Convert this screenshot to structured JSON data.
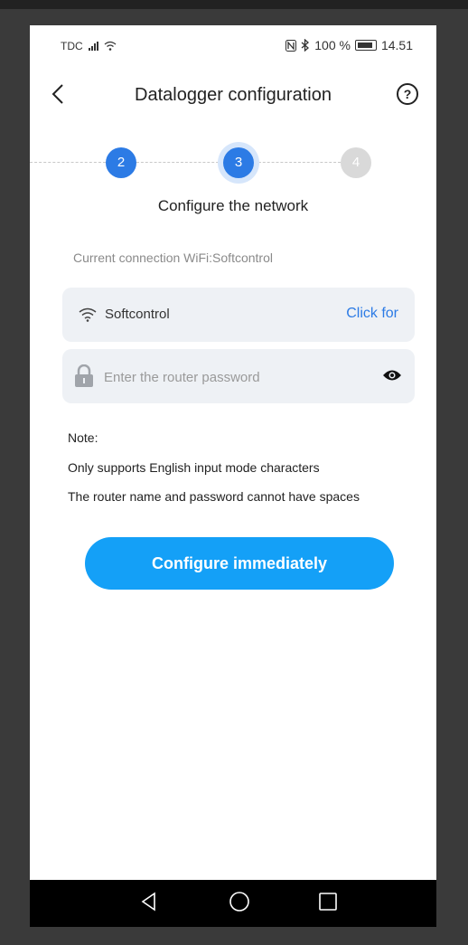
{
  "status_bar": {
    "carrier": "TDC",
    "battery_text": "100 %",
    "time": "14.51"
  },
  "header": {
    "title": "Datalogger configuration",
    "back_icon": "chevron-left-icon",
    "help_icon": "help-circle-icon",
    "help_glyph": "?"
  },
  "stepper": {
    "steps": [
      {
        "label": "2",
        "state": "done"
      },
      {
        "label": "3",
        "state": "active"
      },
      {
        "label": "4",
        "state": "todo"
      }
    ],
    "caption": "Configure the network"
  },
  "connection": {
    "text": "Current connection WiFi:Softcontrol"
  },
  "wifi_field": {
    "icon": "wifi-icon",
    "ssid": "Softcontrol",
    "action_label": "Click for"
  },
  "password_field": {
    "icon": "lock-icon",
    "placeholder": "Enter the router password",
    "value": "",
    "toggle_icon": "eye-icon"
  },
  "notes": {
    "title": "Note:",
    "lines": [
      "Only supports English input mode characters",
      "The router name and password cannot have spaces"
    ]
  },
  "cta": {
    "label": "Configure immediately"
  },
  "colors": {
    "primary": "#2c7be5",
    "button": "#14a0f7",
    "field_bg": "#eef1f5"
  }
}
